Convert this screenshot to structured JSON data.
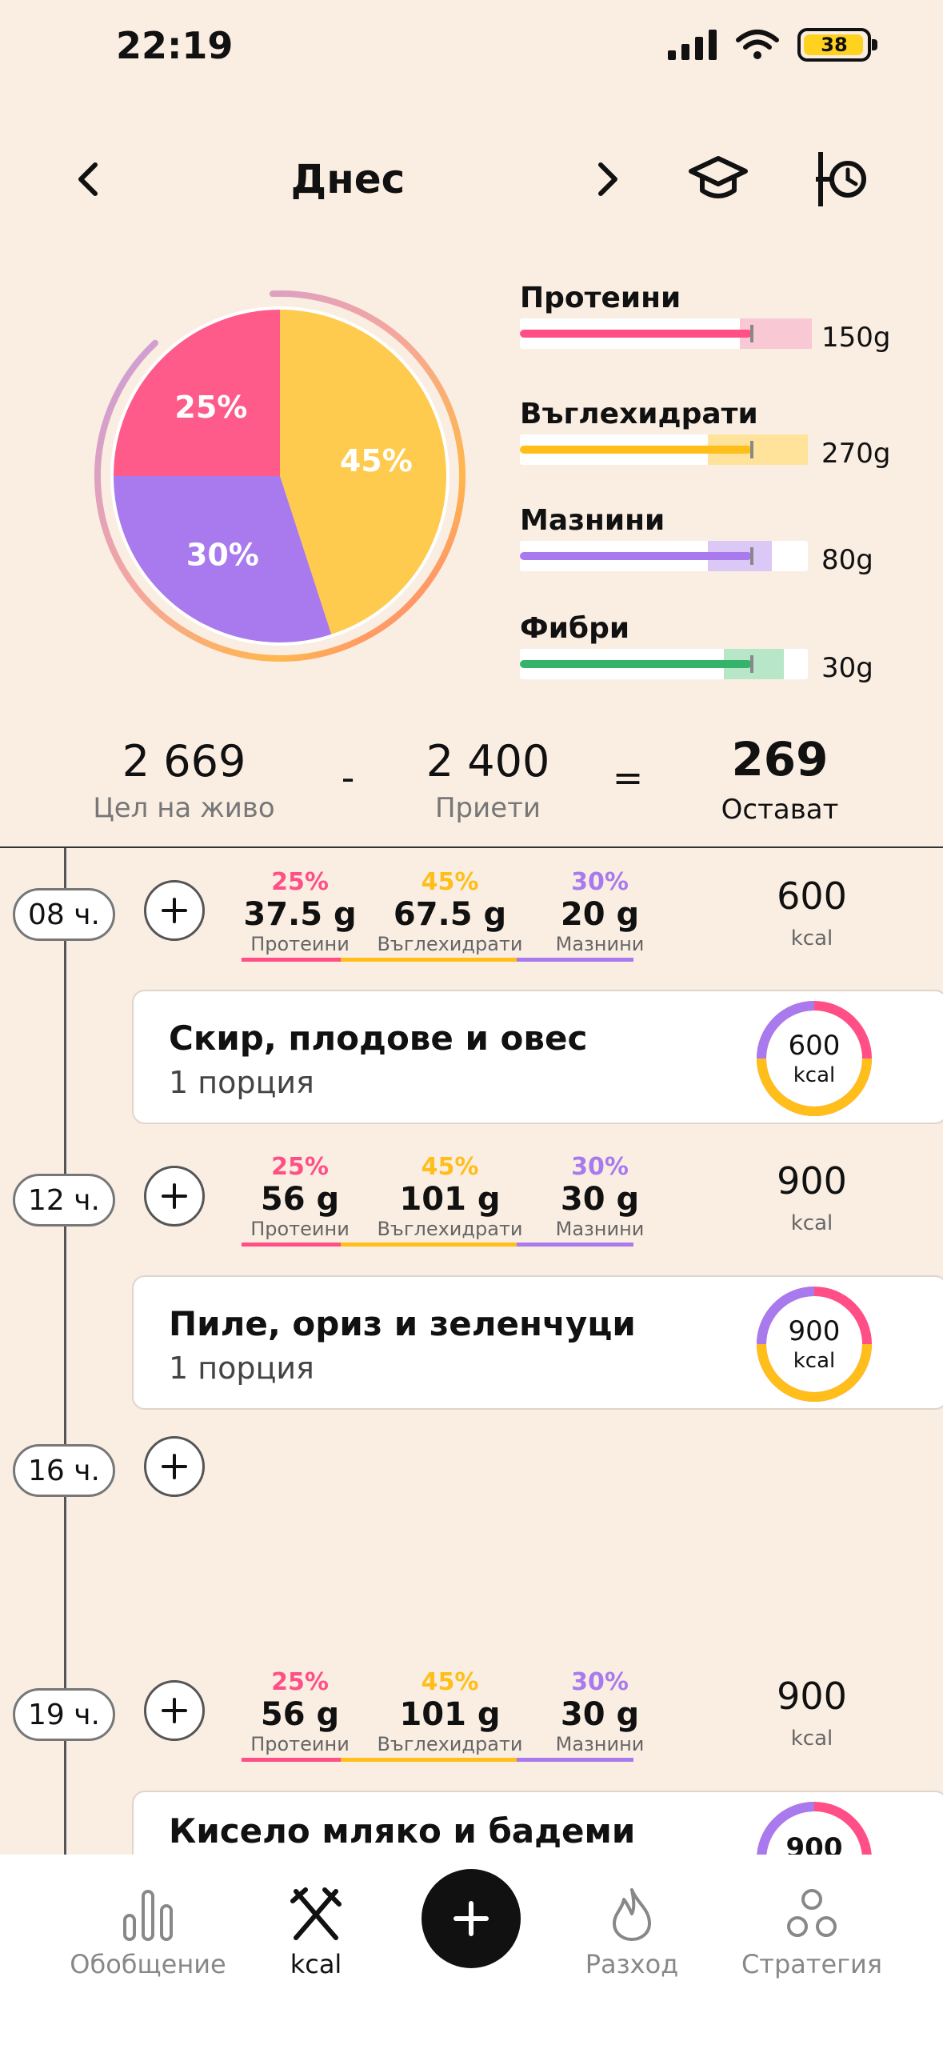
{
  "status": {
    "time": "22:19",
    "battery": "38"
  },
  "header": {
    "title": "Днес"
  },
  "donut": {
    "segments": [
      {
        "percent": 25,
        "label": "25%",
        "color": "#FF5B8A"
      },
      {
        "percent": 45,
        "label": "45%",
        "color": "#FFCB4E"
      },
      {
        "percent": 30,
        "label": "30%",
        "color": "#A97AED"
      }
    ]
  },
  "macros": [
    {
      "name": "Протеини",
      "value": "150g",
      "color": "#FF4F86",
      "band": "#F9C8D5"
    },
    {
      "name": "Въглехидрати",
      "value": "270g",
      "color": "#FFBE1A",
      "band": "#FFE39A"
    },
    {
      "name": "Мазнини",
      "value": "80g",
      "color": "#A97AED",
      "band": "#DCC8F7"
    },
    {
      "name": "Фибри",
      "value": "30g",
      "color": "#36B36A",
      "band": "#B8E6C8"
    }
  ],
  "summary": {
    "live_goal": "2 669",
    "live_goal_label": "Цел на живо",
    "minus": "-",
    "consumed": "2 400",
    "consumed_label": "Приети",
    "equals": "=",
    "remaining": "269",
    "remaining_label": "Остават"
  },
  "slots": [
    {
      "time": "08 ч.",
      "p_pct": "25%",
      "p_g": "37.5 g",
      "c_pct": "45%",
      "c_g": "67.5 g",
      "f_pct": "30%",
      "f_g": "20 g",
      "kcal": "600",
      "kcal_unit": "kcal",
      "meal": {
        "title": "Скир, плодове и овес",
        "portion": "1 порция",
        "kcal": "600",
        "unit": "kcal"
      }
    },
    {
      "time": "12 ч.",
      "p_pct": "25%",
      "p_g": "56 g",
      "c_pct": "45%",
      "c_g": "101 g",
      "f_pct": "30%",
      "f_g": "30 g",
      "kcal": "900",
      "kcal_unit": "kcal",
      "meal": {
        "title": "Пиле, ориз и зеленчуци",
        "portion": "1 порция",
        "kcal": "900",
        "unit": "kcal"
      }
    },
    {
      "time": "16 ч."
    },
    {
      "time": "19 ч.",
      "p_pct": "25%",
      "p_g": "56 g",
      "c_pct": "45%",
      "c_g": "101 g",
      "f_pct": "30%",
      "f_g": "30 g",
      "kcal": "900",
      "kcal_unit": "kcal",
      "meal": {
        "title": "Кисело мляко и бадеми",
        "kcal": "900"
      }
    }
  ],
  "macro_names": {
    "protein": "Протеини",
    "carbs": "Въглехидрати",
    "fat": "Мазнини"
  },
  "tabs": {
    "overview": "Обобщение",
    "kcal": "kcal",
    "expense": "Разход",
    "strategy": "Стратегия"
  }
}
